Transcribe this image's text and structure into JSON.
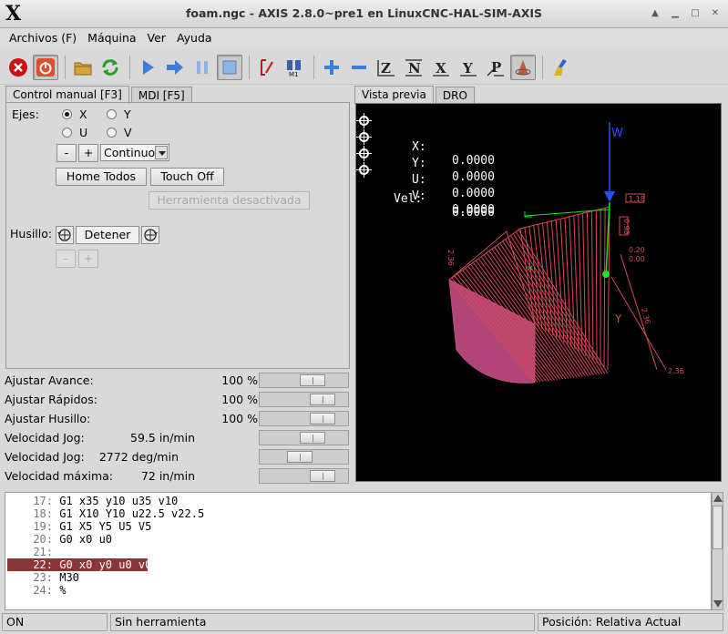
{
  "window": {
    "title": "foam.ngc - AXIS 2.8.0~pre1 en LinuxCNC-HAL-SIM-AXIS",
    "controls": [
      "up-icon",
      "minimize-icon",
      "maximize-icon",
      "close-icon"
    ]
  },
  "menubar": {
    "items": [
      "Archivos (F)",
      "Máquina",
      "Ver",
      "Ayuda"
    ]
  },
  "toolbar": {
    "icons": [
      "estop-icon",
      "power-icon",
      "open-file-icon",
      "reload-icon",
      "run-icon",
      "step-icon",
      "pause-icon",
      "stop-icon",
      "block-delete-icon",
      "optional-stop-icon",
      "zoom-in-icon",
      "zoom-out-icon",
      "view-z-icon",
      "view-z2-icon",
      "view-x-icon",
      "view-y-icon",
      "view-p-icon",
      "rotate-view-icon",
      "clear-plot-icon"
    ]
  },
  "left_tabs": [
    "Control manual [F3]",
    "MDI [F5]"
  ],
  "manual": {
    "axes_label": "Ejes:",
    "axes": [
      {
        "label": "X",
        "selected": true
      },
      {
        "label": "Y",
        "selected": false
      },
      {
        "label": "U",
        "selected": false
      },
      {
        "label": "V",
        "selected": false
      }
    ],
    "minus": "-",
    "plus": "+",
    "jog_mode": "Continuo",
    "home_all": "Home Todos",
    "touch_off": "Touch Off",
    "tool_off": "Herramienta desactivada",
    "spindle_label": "Husillo:",
    "spindle_stop": "Detener",
    "spindle_minus": "-",
    "spindle_plus": "+"
  },
  "sliders": [
    {
      "name": "Ajustar Avance:",
      "value": "100 %",
      "fraction": 0.66
    },
    {
      "name": "Ajustar Rápidos:",
      "value": "100 %",
      "fraction": 0.82
    },
    {
      "name": "Ajustar Husillo:",
      "value": "100 %",
      "fraction": 0.82
    },
    {
      "name": "Velocidad Jog:",
      "value": "59.5 in/min",
      "fraction": 0.66
    },
    {
      "name": "Velocidad Jog:",
      "value": "2772 deg/min",
      "fraction": 0.45
    },
    {
      "name": "Velocidad máxima:",
      "value": "72 in/min",
      "fraction": 0.82
    }
  ],
  "right_tabs": [
    "Vista previa",
    "DRO"
  ],
  "dro": [
    {
      "axis": "X:",
      "value": "0.0000"
    },
    {
      "axis": "Y:",
      "value": "0.0000"
    },
    {
      "axis": "U:",
      "value": "0.0000"
    },
    {
      "axis": "V:",
      "value": "0.0000"
    },
    {
      "axis": "Vel:",
      "value": "0.0000"
    }
  ],
  "preview_labels": {
    "w_axis": "W",
    "dim1": "1.18",
    "dim2": "0.98",
    "dim3": "0.20",
    "dim4": "0.00",
    "dim5": "2.36",
    "dim6": "2.36",
    "dim7": "2.36",
    "y_glyph": "Y"
  },
  "colors": {
    "preview_bg": "#000000",
    "toolpath": "#d84a55",
    "highlight_line": "#8b3636",
    "axis_blue": "#2a4cff",
    "axis_green": "#22dd22"
  },
  "code": [
    {
      "num": "17:",
      "text": "G1 x35 y10 u35 v10",
      "highlight": false
    },
    {
      "num": "18:",
      "text": "G1 X10 Y10 u22.5 v22.5",
      "highlight": false
    },
    {
      "num": "19:",
      "text": "G1 X5 Y5 U5 V5",
      "highlight": false
    },
    {
      "num": "20:",
      "text": "G0 x0 u0",
      "highlight": false
    },
    {
      "num": "21:",
      "text": "",
      "highlight": false
    },
    {
      "num": "22:",
      "text": "G0 x0 y0 u0 v0",
      "highlight": true
    },
    {
      "num": "23:",
      "text": "M30",
      "highlight": false
    },
    {
      "num": "24:",
      "text": "%",
      "highlight": false
    }
  ],
  "status": {
    "machine": "ON",
    "tool": "Sin herramienta",
    "position": "Posición: Relativa Actual"
  }
}
